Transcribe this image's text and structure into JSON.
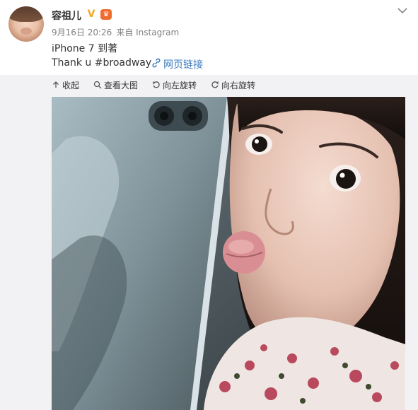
{
  "post": {
    "username": "容祖儿",
    "verified_badge": "V",
    "member_badge": "♛",
    "timestamp": "9月16日 20:26",
    "source": "来自 Instagram",
    "text_line1": "iPhone 7 到著",
    "text_line2": "Thank u #broadway",
    "link_label": "网页链接"
  },
  "toolbar": {
    "collapse_label": "收起",
    "view_large_label": "查看大图",
    "rotate_left_label": "向左旋转",
    "rotate_right_label": "向右旋转"
  },
  "colors": {
    "link": "#3b7bbf",
    "meta_gray": "#808080",
    "panel_background": "#f2f2f5",
    "verified": "#f5a623"
  },
  "icons": {
    "dropdown": "chevron-down-icon",
    "link": "link-icon",
    "collapse": "arrow-up-icon",
    "view_large": "magnifier-icon",
    "rotate_left": "rotate-left-icon",
    "rotate_right": "rotate-right-icon"
  }
}
